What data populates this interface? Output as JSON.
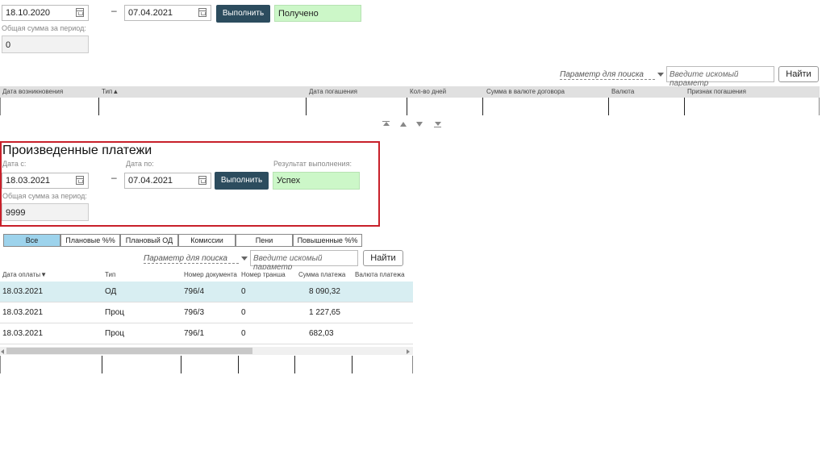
{
  "top_section": {
    "date_from_value": "18.10.2020",
    "dash": "–",
    "date_to_value": "07.04.2021",
    "run_button": "Выполнить",
    "status": "Получено",
    "total_label": "Общая сумма за период:",
    "total_value": "0"
  },
  "top_search": {
    "param_label": "Параметр для поиска",
    "search_placeholder": "Введите искомый параметр",
    "find_button": "Найти"
  },
  "top_table": {
    "columns": [
      "Дата возникновения",
      "Тип▲",
      "Дата погашения",
      "Кол-во дней",
      "Сумма в валюте договора",
      "Валюта",
      "Признак погашения"
    ]
  },
  "payments_section": {
    "title": "Произведенные платежи",
    "date_from_label": "Дата с:",
    "date_from_value": "18.03.2021",
    "dash": "–",
    "date_to_label": "Дата по:",
    "date_to_value": "07.04.2021",
    "run_button": "Выполнить",
    "result_label": "Результат выполнения:",
    "result_value": "Успех",
    "total_label": "Общая сумма за период:",
    "total_value": "9999"
  },
  "tabs": [
    "Все",
    "Плановые %%",
    "Плановый ОД",
    "Комиссии",
    "Пени",
    "Повышенные %%"
  ],
  "payments_search": {
    "param_label": "Параметр для поиска",
    "search_placeholder": "Введите искомый параметр",
    "find_button": "Найти"
  },
  "payments_table": {
    "columns": [
      "Дата оплаты▼",
      "Тип",
      "Номер документа",
      "Номер транша",
      "Сумма платежа",
      "Валюта платежа"
    ],
    "rows": [
      [
        "18.03.2021",
        "ОД",
        "796/4",
        "0",
        "8 090,32"
      ],
      [
        "18.03.2021",
        "Проц",
        "796/3",
        "0",
        "1 227,65"
      ],
      [
        "18.03.2021",
        "Проц",
        "796/1",
        "0",
        "682,03"
      ]
    ]
  },
  "colors": {
    "accent_button": "#2c4c5e",
    "success_bg": "#ccf7c8",
    "active_tab": "#9dd3ec",
    "selected_row": "#d8eef2",
    "highlight_border": "#c8202a"
  }
}
